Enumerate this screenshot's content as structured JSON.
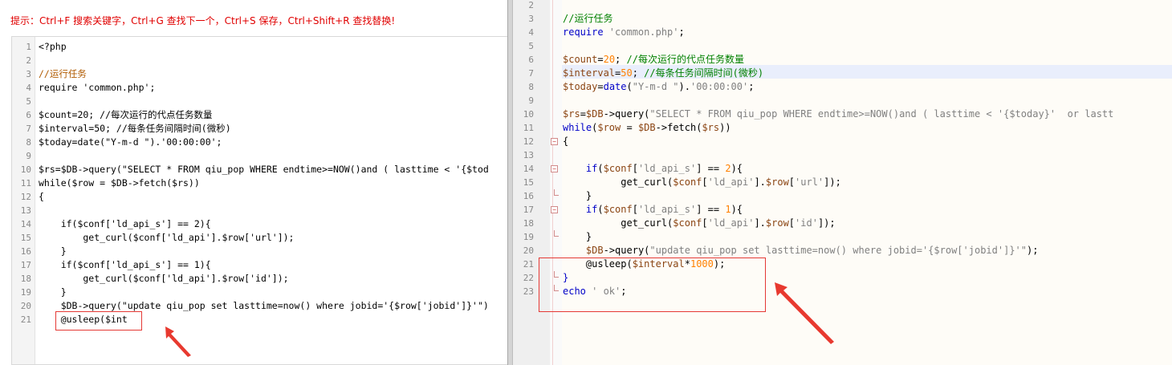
{
  "tip": "提示：Ctrl+F 搜索关键字，Ctrl+G 查找下一个，Ctrl+S 保存，Ctrl+Shift+R 查找替换!",
  "left_lines": [
    {
      "n": "1",
      "t": "<?php"
    },
    {
      "n": "2",
      "t": ""
    },
    {
      "n": "3",
      "t": "//运行任务"
    },
    {
      "n": "4",
      "t": "require 'common.php';"
    },
    {
      "n": "5",
      "t": ""
    },
    {
      "n": "6",
      "t": "$count=20; //每次运行的代点任务数量"
    },
    {
      "n": "7",
      "t": "$interval=50; //每条任务间隔时间(微秒)"
    },
    {
      "n": "8",
      "t": "$today=date(\"Y-m-d \").'00:00:00';"
    },
    {
      "n": "9",
      "t": ""
    },
    {
      "n": "10",
      "t": "$rs=$DB->query(\"SELECT * FROM qiu_pop WHERE endtime>=NOW()and ( lasttime < '{$tod"
    },
    {
      "n": "11",
      "t": "while($row = $DB->fetch($rs))"
    },
    {
      "n": "12",
      "t": "{"
    },
    {
      "n": "13",
      "t": ""
    },
    {
      "n": "14",
      "t": "    if($conf['ld_api_s'] == 2){"
    },
    {
      "n": "15",
      "t": "        get_curl($conf['ld_api'].$row['url']);"
    },
    {
      "n": "16",
      "t": "    }"
    },
    {
      "n": "17",
      "t": "    if($conf['ld_api_s'] == 1){"
    },
    {
      "n": "18",
      "t": "        get_curl($conf['ld_api'].$row['id']);"
    },
    {
      "n": "19",
      "t": "    }"
    },
    {
      "n": "20",
      "t": "    $DB->query(\"update qiu_pop set lasttime=now() where jobid='{$row['jobid']}'\")"
    },
    {
      "n": "21",
      "t": "    @usleep($int"
    }
  ],
  "right_lines": [
    {
      "n": "2",
      "fold": "",
      "s": []
    },
    {
      "n": "3",
      "fold": "",
      "s": [
        {
          "c": "cm",
          "t": "//运行任务"
        }
      ]
    },
    {
      "n": "4",
      "fold": "",
      "s": [
        {
          "c": "kw",
          "t": "require"
        },
        {
          "c": "str",
          "t": " 'common.php'"
        },
        {
          "c": "plain",
          "t": ";"
        }
      ]
    },
    {
      "n": "5",
      "fold": "",
      "s": []
    },
    {
      "n": "6",
      "fold": "",
      "s": [
        {
          "c": "var",
          "t": "$count"
        },
        {
          "c": "plain",
          "t": "="
        },
        {
          "c": "num",
          "t": "20"
        },
        {
          "c": "plain",
          "t": "; "
        },
        {
          "c": "cm",
          "t": "//每次运行的代点任务数量"
        }
      ]
    },
    {
      "n": "7",
      "fold": "",
      "s": [
        {
          "c": "var",
          "t": "$interval"
        },
        {
          "c": "plain",
          "t": "="
        },
        {
          "c": "num",
          "t": "50"
        },
        {
          "c": "plain",
          "t": "; "
        },
        {
          "c": "cm",
          "t": "//每条任务间隔时间(微秒)"
        }
      ]
    },
    {
      "n": "8",
      "fold": "",
      "s": [
        {
          "c": "var",
          "t": "$today"
        },
        {
          "c": "plain",
          "t": "="
        },
        {
          "c": "kw",
          "t": "date"
        },
        {
          "c": "plain",
          "t": "("
        },
        {
          "c": "str",
          "t": "\"Y-m-d \""
        },
        {
          "c": "plain",
          "t": ")."
        },
        {
          "c": "str",
          "t": "'00:00:00'"
        },
        {
          "c": "plain",
          "t": ";"
        }
      ]
    },
    {
      "n": "9",
      "fold": "",
      "s": []
    },
    {
      "n": "10",
      "fold": "",
      "s": [
        {
          "c": "var",
          "t": "$rs"
        },
        {
          "c": "plain",
          "t": "="
        },
        {
          "c": "var",
          "t": "$DB"
        },
        {
          "c": "plain",
          "t": "->query("
        },
        {
          "c": "str",
          "t": "\"SELECT * FROM qiu_pop WHERE endtime>=NOW()and ( lasttime < '{$today}'  or lastt"
        }
      ]
    },
    {
      "n": "11",
      "fold": "",
      "s": [
        {
          "c": "kw",
          "t": "while"
        },
        {
          "c": "plain",
          "t": "("
        },
        {
          "c": "var",
          "t": "$row"
        },
        {
          "c": "plain",
          "t": " = "
        },
        {
          "c": "var",
          "t": "$DB"
        },
        {
          "c": "plain",
          "t": "->fetch("
        },
        {
          "c": "var",
          "t": "$rs"
        },
        {
          "c": "plain",
          "t": "))"
        }
      ]
    },
    {
      "n": "12",
      "fold": "box",
      "s": [
        {
          "c": "plain",
          "t": "{"
        }
      ]
    },
    {
      "n": "13",
      "fold": "",
      "s": []
    },
    {
      "n": "14",
      "fold": "box",
      "s": [
        {
          "c": "plain",
          "t": "    "
        },
        {
          "c": "kw",
          "t": "if"
        },
        {
          "c": "plain",
          "t": "("
        },
        {
          "c": "var",
          "t": "$conf"
        },
        {
          "c": "plain",
          "t": "["
        },
        {
          "c": "str",
          "t": "'ld_api_s'"
        },
        {
          "c": "plain",
          "t": "] == "
        },
        {
          "c": "num",
          "t": "2"
        },
        {
          "c": "plain",
          "t": "){"
        }
      ]
    },
    {
      "n": "15",
      "fold": "",
      "s": [
        {
          "c": "plain",
          "t": "          get_curl("
        },
        {
          "c": "var",
          "t": "$conf"
        },
        {
          "c": "plain",
          "t": "["
        },
        {
          "c": "str",
          "t": "'ld_api'"
        },
        {
          "c": "plain",
          "t": "]."
        },
        {
          "c": "var",
          "t": "$row"
        },
        {
          "c": "plain",
          "t": "["
        },
        {
          "c": "str",
          "t": "'url'"
        },
        {
          "c": "plain",
          "t": "]);"
        }
      ]
    },
    {
      "n": "16",
      "fold": "tick",
      "s": [
        {
          "c": "plain",
          "t": "    }"
        }
      ]
    },
    {
      "n": "17",
      "fold": "box",
      "s": [
        {
          "c": "plain",
          "t": "    "
        },
        {
          "c": "kw",
          "t": "if"
        },
        {
          "c": "plain",
          "t": "("
        },
        {
          "c": "var",
          "t": "$conf"
        },
        {
          "c": "plain",
          "t": "["
        },
        {
          "c": "str",
          "t": "'ld_api_s'"
        },
        {
          "c": "plain",
          "t": "] == "
        },
        {
          "c": "num",
          "t": "1"
        },
        {
          "c": "plain",
          "t": "){"
        }
      ]
    },
    {
      "n": "18",
      "fold": "",
      "s": [
        {
          "c": "plain",
          "t": "          get_curl("
        },
        {
          "c": "var",
          "t": "$conf"
        },
        {
          "c": "plain",
          "t": "["
        },
        {
          "c": "str",
          "t": "'ld_api'"
        },
        {
          "c": "plain",
          "t": "]."
        },
        {
          "c": "var",
          "t": "$row"
        },
        {
          "c": "plain",
          "t": "["
        },
        {
          "c": "str",
          "t": "'id'"
        },
        {
          "c": "plain",
          "t": "]);"
        }
      ]
    },
    {
      "n": "19",
      "fold": "tick",
      "s": [
        {
          "c": "plain",
          "t": "    }"
        }
      ]
    },
    {
      "n": "20",
      "fold": "",
      "s": [
        {
          "c": "plain",
          "t": "    "
        },
        {
          "c": "var",
          "t": "$DB"
        },
        {
          "c": "plain",
          "t": "->query("
        },
        {
          "c": "str",
          "t": "\"update qiu_pop set lasttime=now() where jobid='{$row['jobid']}'\""
        },
        {
          "c": "plain",
          "t": ");"
        }
      ]
    },
    {
      "n": "21",
      "fold": "",
      "s": [
        {
          "c": "plain",
          "t": "    @usleep("
        },
        {
          "c": "var",
          "t": "$interval"
        },
        {
          "c": "plain",
          "t": "*"
        },
        {
          "c": "num",
          "t": "1000"
        },
        {
          "c": "plain",
          "t": ");"
        }
      ]
    },
    {
      "n": "22",
      "fold": "tick",
      "s": [
        {
          "c": "kw",
          "t": "}"
        }
      ]
    },
    {
      "n": "23",
      "fold": "tick",
      "s": [
        {
          "c": "kw",
          "t": "echo"
        },
        {
          "c": "str",
          "t": " ' ok'"
        },
        {
          "c": "plain",
          "t": ";"
        }
      ]
    }
  ]
}
